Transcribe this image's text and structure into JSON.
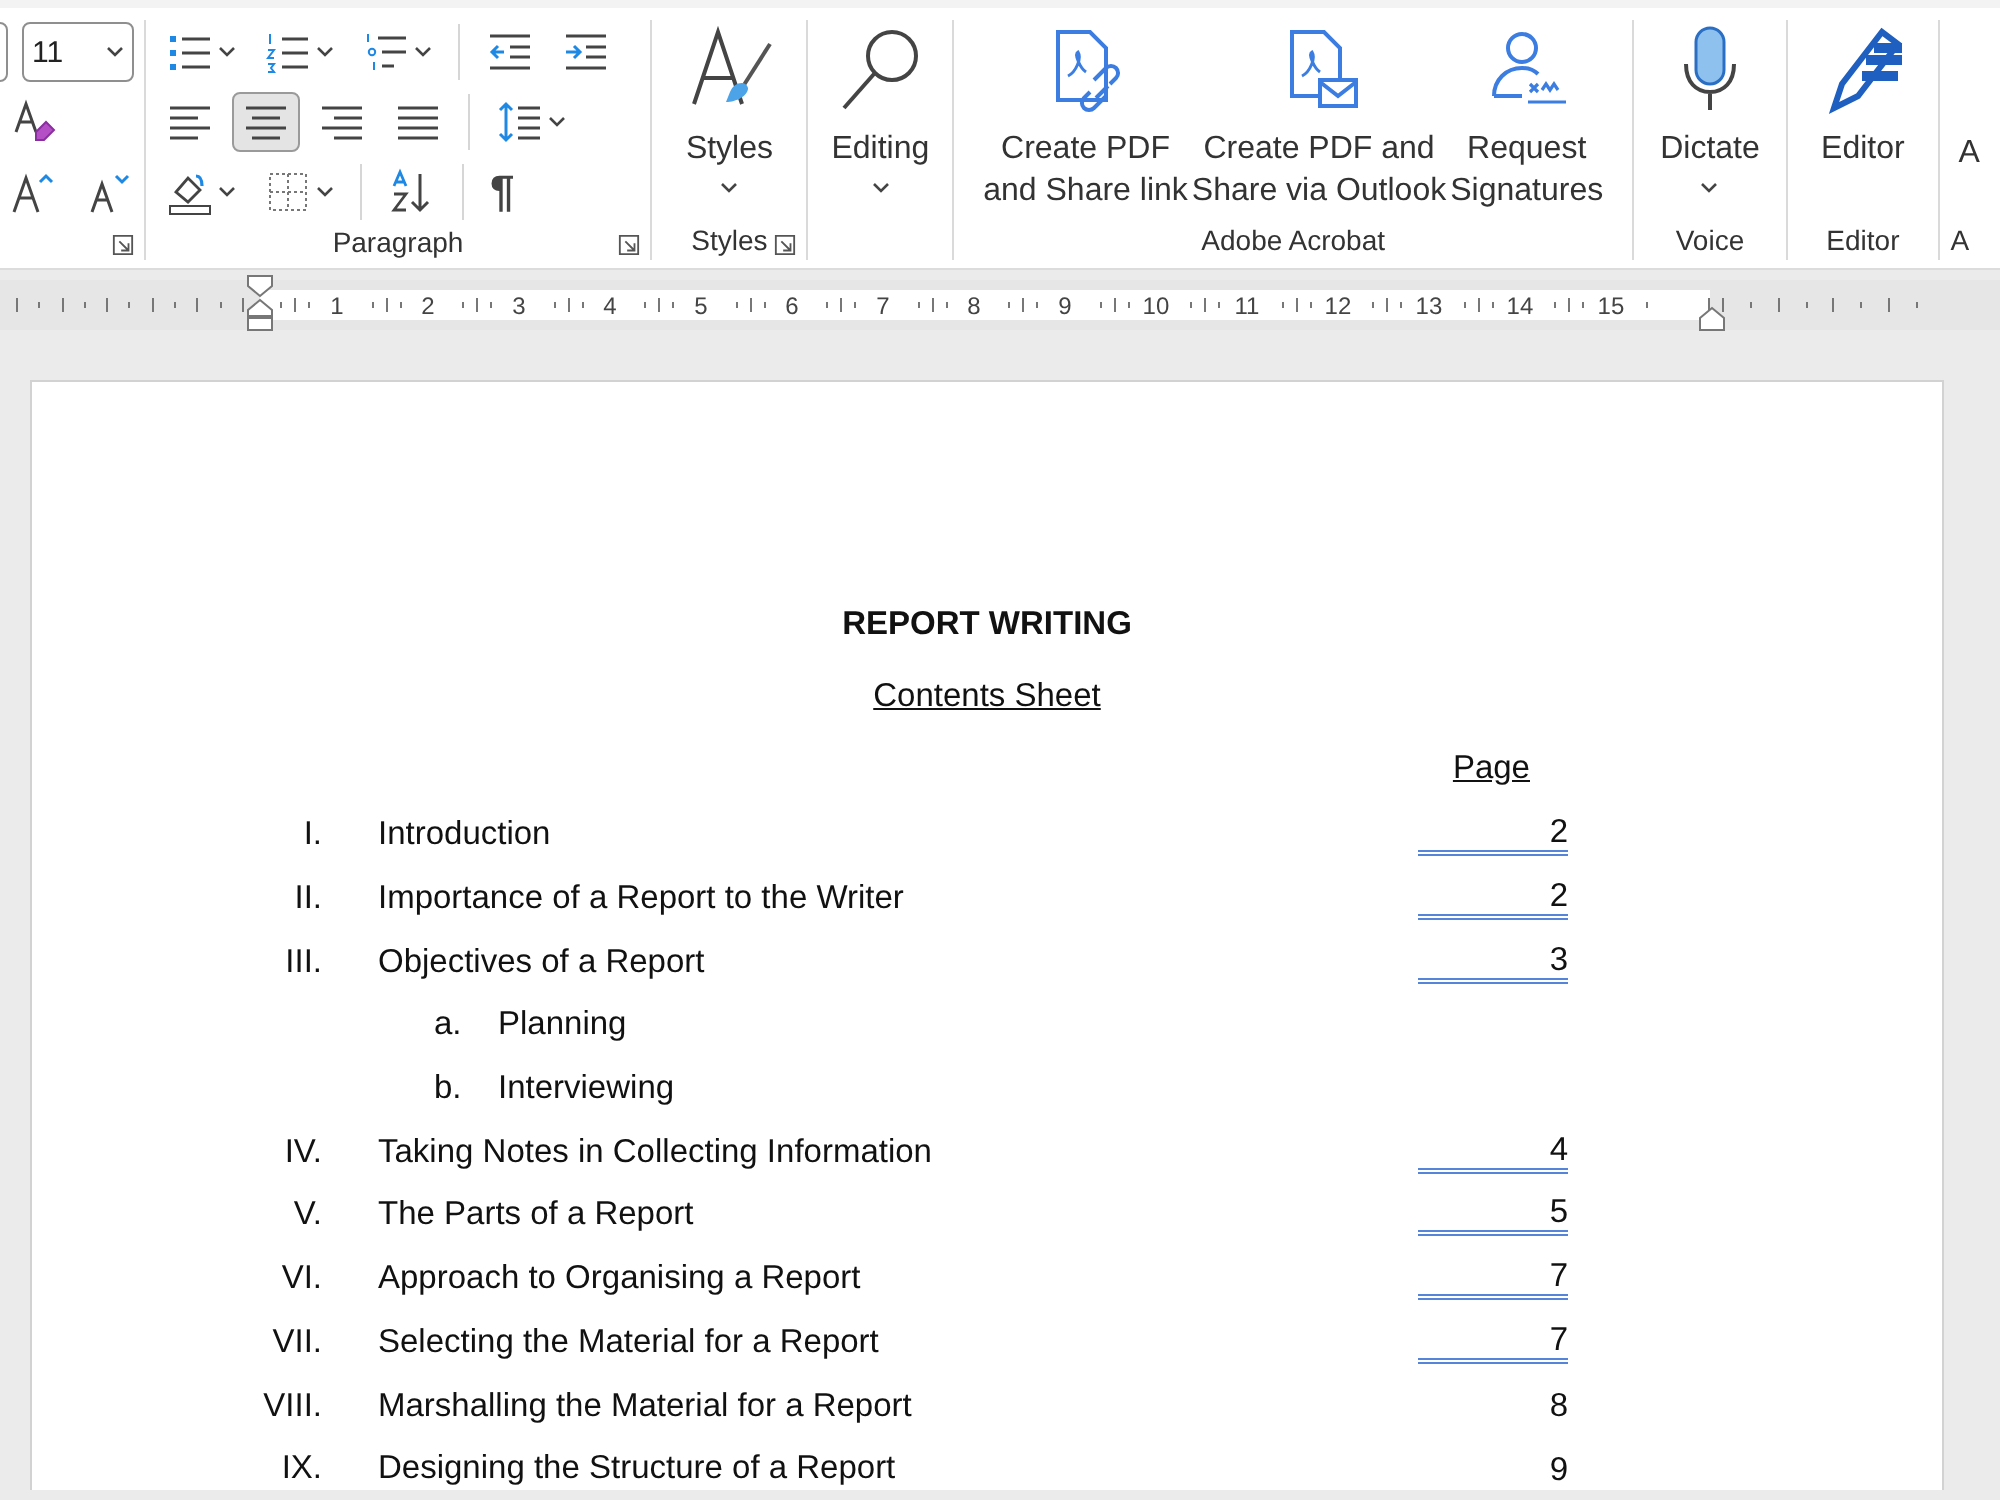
{
  "ribbon": {
    "font_group": {
      "font_size": "11"
    },
    "paragraph_group": {
      "label": "Paragraph",
      "alignment": [
        {
          "kind": "left",
          "selected": false
        },
        {
          "kind": "center",
          "selected": true
        },
        {
          "kind": "right",
          "selected": false
        },
        {
          "kind": "justify",
          "selected": false
        }
      ],
      "show_marks_symbol": "¶"
    },
    "styles_group": {
      "button": "Styles",
      "label": "Styles"
    },
    "editing_group": {
      "button": "Editing"
    },
    "acrobat_group": {
      "label": "Adobe Acrobat",
      "buttons": [
        {
          "kind": "pdf-link",
          "lines": [
            "Create PDF",
            "and Share link"
          ]
        },
        {
          "kind": "pdf-mail",
          "lines": [
            "Create PDF and",
            "Share via Outlook"
          ]
        },
        {
          "kind": "signature",
          "lines": [
            "Request",
            "Signatures"
          ]
        }
      ]
    },
    "voice_group": {
      "button": "Dictate",
      "label": "Voice"
    },
    "editor_group": {
      "button": "Editor",
      "label": "Editor"
    },
    "cut_group": {
      "button": "A",
      "label": "A"
    }
  },
  "ruler": {
    "marks": [
      "1",
      "2",
      "3",
      "4",
      "5",
      "6",
      "7",
      "8",
      "9",
      "10",
      "11",
      "12",
      "13",
      "14",
      "15"
    ]
  },
  "document": {
    "title": "REPORT WRITING",
    "subtitle": "Contents Sheet",
    "page_heading": "Page",
    "entries": [
      {
        "numeral": "I.",
        "title": "Introduction",
        "page": "2",
        "linked": true
      },
      {
        "numeral": "II.",
        "title": "Importance of a Report to the Writer",
        "page": "2",
        "linked": true
      },
      {
        "numeral": "III.",
        "title": "Objectives of a Report",
        "page": "3",
        "linked": true,
        "children": [
          {
            "numeral": "a.",
            "title": "Planning"
          },
          {
            "numeral": "b.",
            "title": "Interviewing"
          }
        ]
      },
      {
        "numeral": "IV.",
        "title": "Taking Notes in Collecting Information",
        "page": "4",
        "linked": true
      },
      {
        "numeral": "V.",
        "title": "The Parts of a Report",
        "page": "5",
        "linked": true
      },
      {
        "numeral": "VI.",
        "title": "Approach to Organising a Report",
        "page": "7",
        "linked": true
      },
      {
        "numeral": "VII.",
        "title": "Selecting the Material for a Report",
        "page": "7",
        "linked": true
      },
      {
        "numeral": "VIII.",
        "title": "Marshalling the Material for a Report",
        "page": "8",
        "linked": false
      },
      {
        "numeral": "IX.",
        "title": "Designing the Structure of a Report",
        "page": "9",
        "linked": false
      }
    ]
  }
}
